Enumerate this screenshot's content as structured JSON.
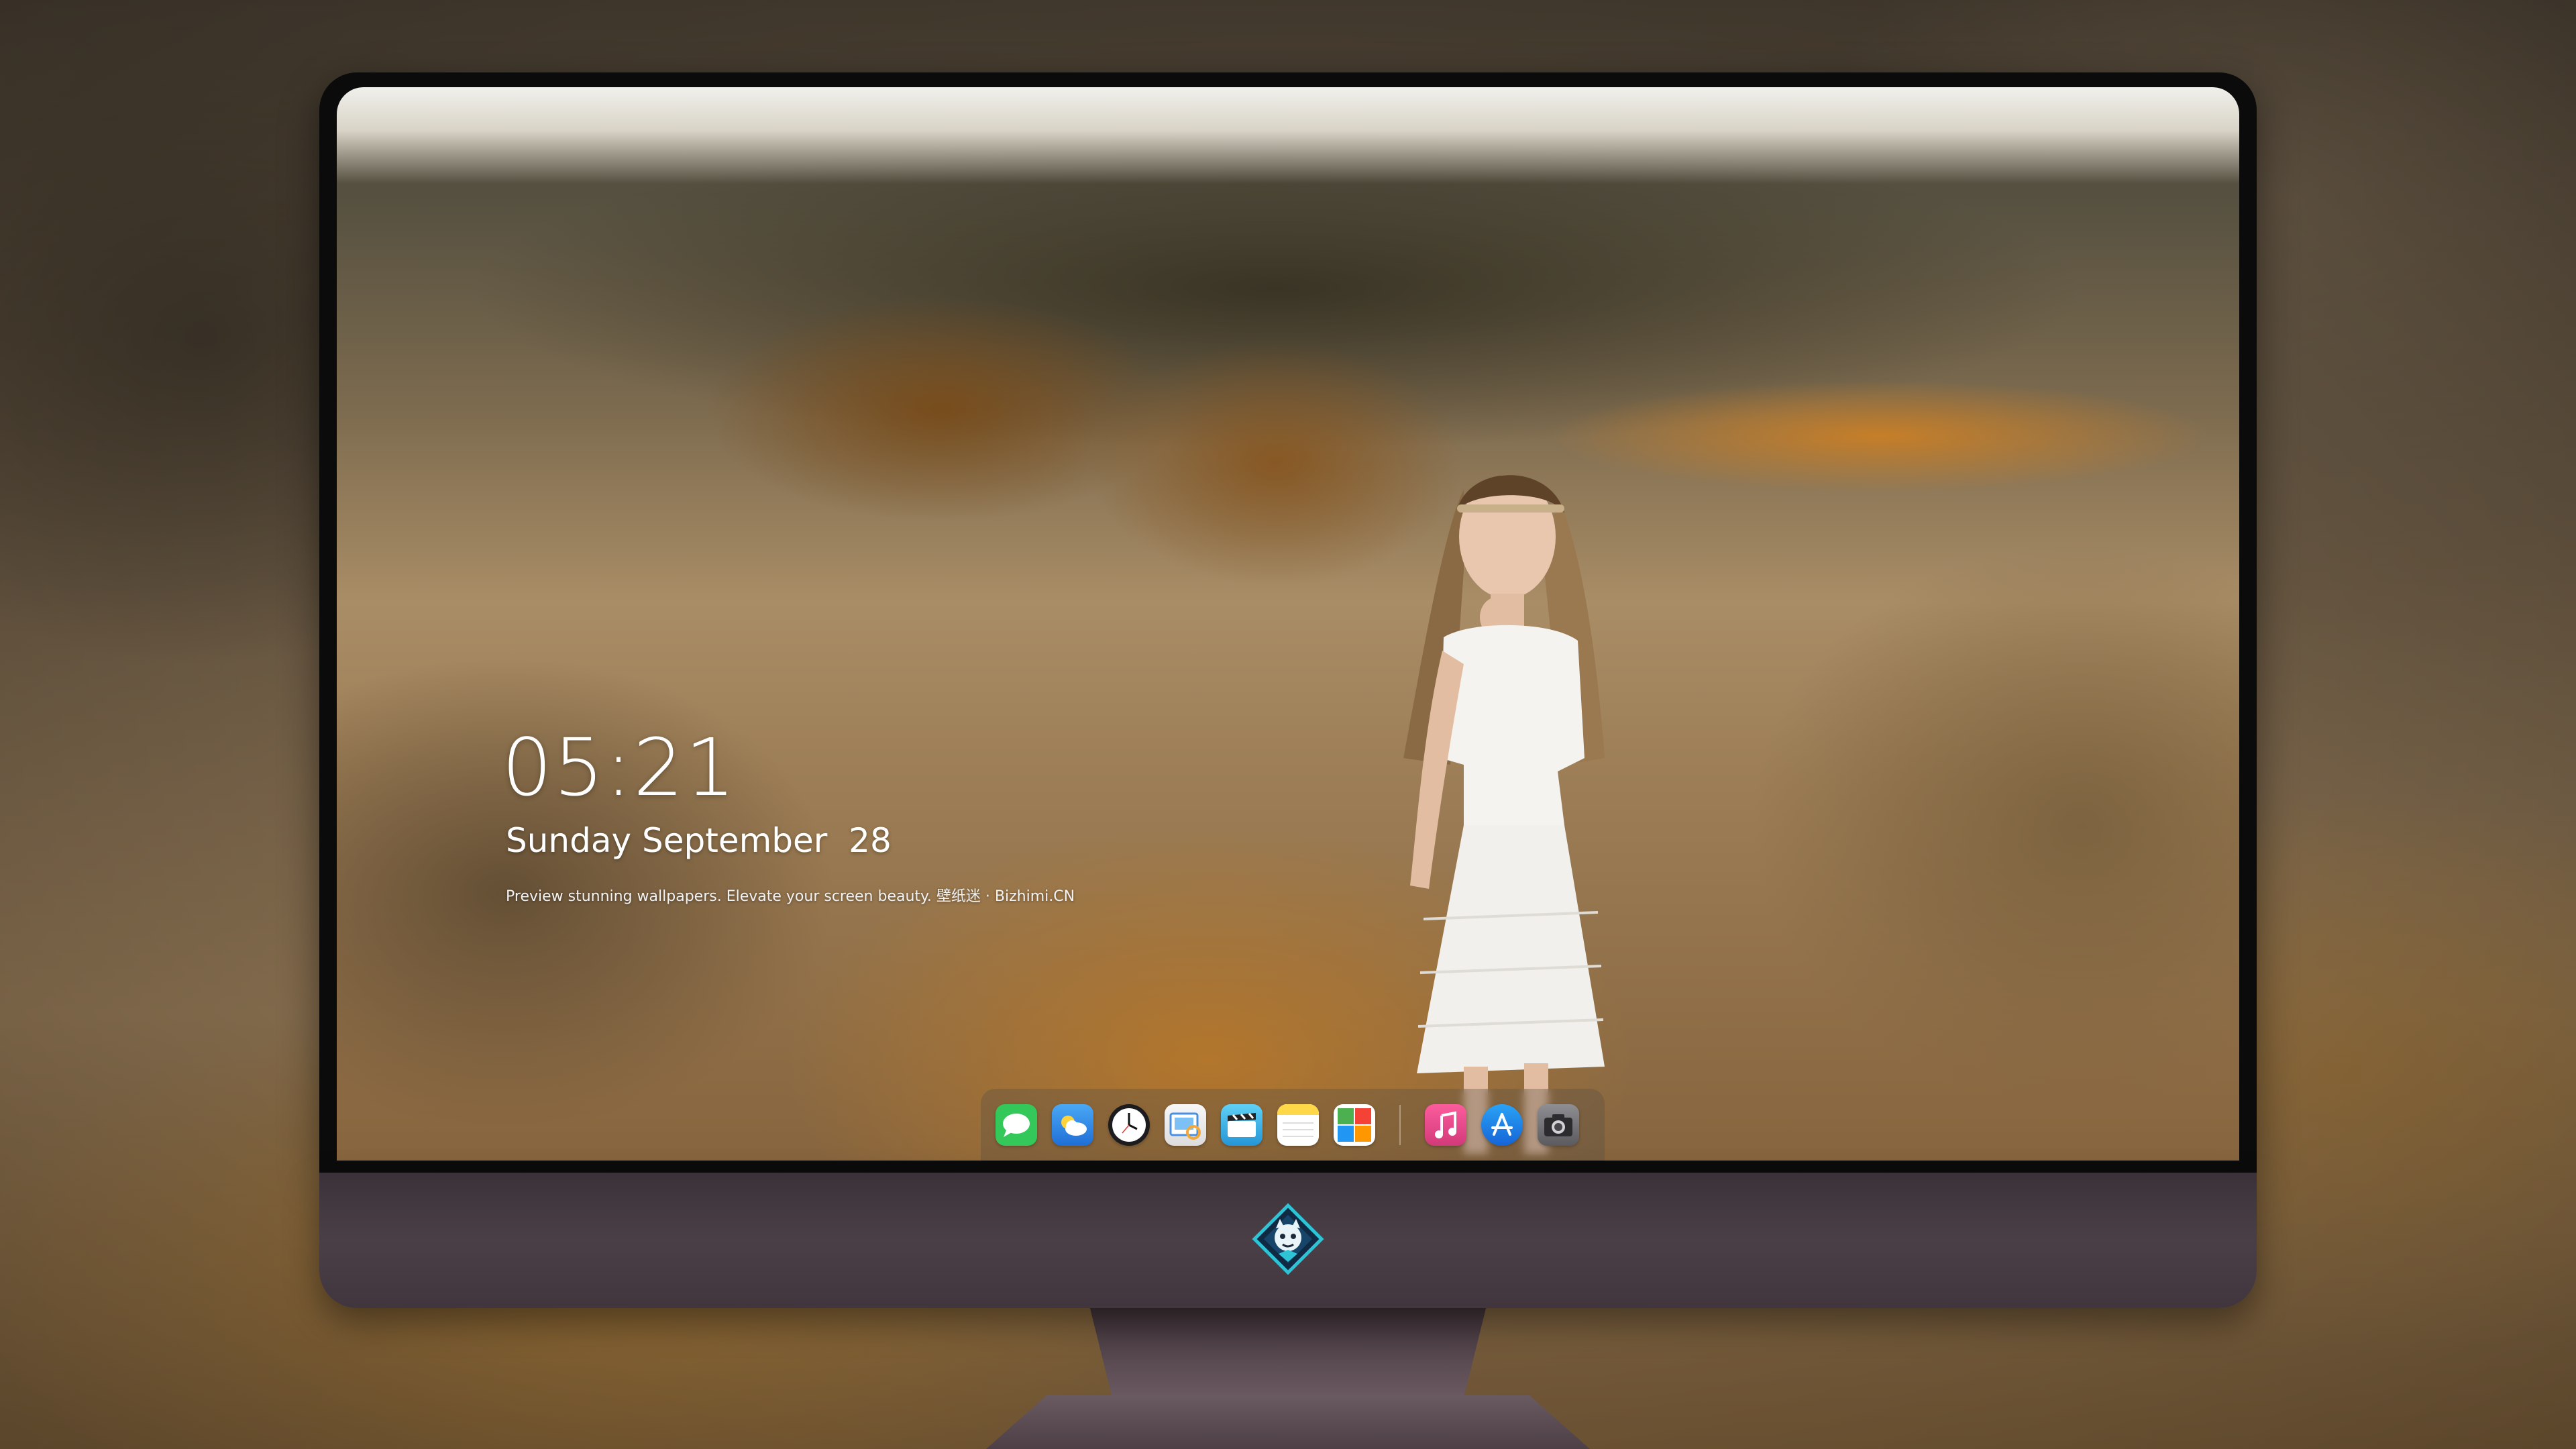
{
  "lock_screen": {
    "time": "05:21",
    "date": "Sunday September  28",
    "tagline": "Preview stunning wallpapers. Elevate your screen beauty. 壁纸迷 · Bizhimi.CN"
  },
  "dock": {
    "apps": [
      {
        "name": "messages-icon",
        "color": "#34c759"
      },
      {
        "name": "weather-icon",
        "color": "#2d8ef0"
      },
      {
        "name": "clock-icon",
        "color": "#1c1c1e"
      },
      {
        "name": "preview-icon",
        "color": "#f3c34a"
      },
      {
        "name": "clips-icon",
        "color": "#30b0e6"
      },
      {
        "name": "notes-icon",
        "color": "#ffd84a"
      },
      {
        "name": "photo-booth-icon",
        "color": "#e9423a"
      },
      {
        "name": "music-icon",
        "color": "#f54a8f"
      },
      {
        "name": "app-store-icon",
        "color": "#1e88f2"
      },
      {
        "name": "camera-icon",
        "color": "#6e6e73"
      }
    ]
  },
  "brand": {
    "accent": "#2ec4d6"
  }
}
